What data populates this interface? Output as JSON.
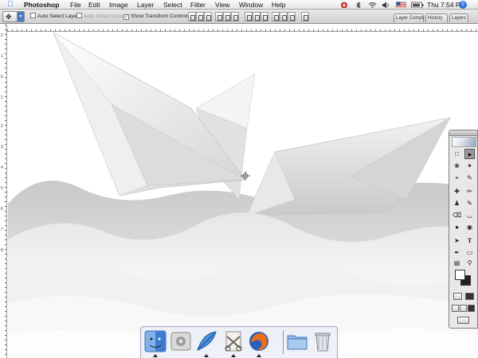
{
  "menubar": {
    "app_name": "Photoshop",
    "menus": [
      "File",
      "Edit",
      "Image",
      "Layer",
      "Select",
      "Filter",
      "View",
      "Window",
      "Help"
    ],
    "clock": "Thu 7:54 PM",
    "status_icons": [
      "virus-scan-icon",
      "bluetooth-icon",
      "wifi-icon",
      "volume-icon",
      "flag-icon",
      "battery-icon"
    ]
  },
  "options_bar": {
    "auto_select_layer": {
      "label": "Auto Select Layer",
      "checked": false
    },
    "auto_select_groups": {
      "label": "Auto Select Groups",
      "checked": false,
      "enabled": false
    },
    "show_transform_controls": {
      "label": "Show Transform Controls",
      "checked": true
    },
    "palette_well_tabs": [
      "Layer Comps",
      "History",
      "Layers"
    ]
  },
  "rulers": {
    "left_numbers": [
      "2",
      "1",
      "0",
      "1",
      "2",
      "3",
      "4",
      "5",
      "6",
      "7",
      "8"
    ]
  },
  "tools_palette": {
    "selected_tool": "move-tool",
    "tool_icons": [
      "marquee",
      "move",
      "lasso",
      "magic-wand",
      "crop",
      "slice",
      "healing-brush",
      "brush",
      "clone-stamp",
      "history-brush",
      "eraser",
      "gradient",
      "blur",
      "dodge",
      "path-selection",
      "type",
      "pen",
      "shape",
      "notes",
      "eyedropper",
      "hand",
      "zoom"
    ],
    "foreground_color": "#ffffff",
    "background_color": "#222222"
  },
  "dock": {
    "items": [
      {
        "name": "Finder",
        "running": true
      },
      {
        "name": "System Preferences",
        "running": false
      },
      {
        "name": "Photoshop",
        "running": true
      },
      {
        "name": "Script Editor",
        "running": true
      },
      {
        "name": "Firefox",
        "running": true
      },
      {
        "name": "Documents Folder",
        "running": false
      },
      {
        "name": "Trash",
        "running": false
      }
    ]
  },
  "colors": {
    "menubar_accent": "#2f6fd6",
    "toolbar_bg": "#dcdcdc",
    "canvas_bg": "#ffffff"
  }
}
